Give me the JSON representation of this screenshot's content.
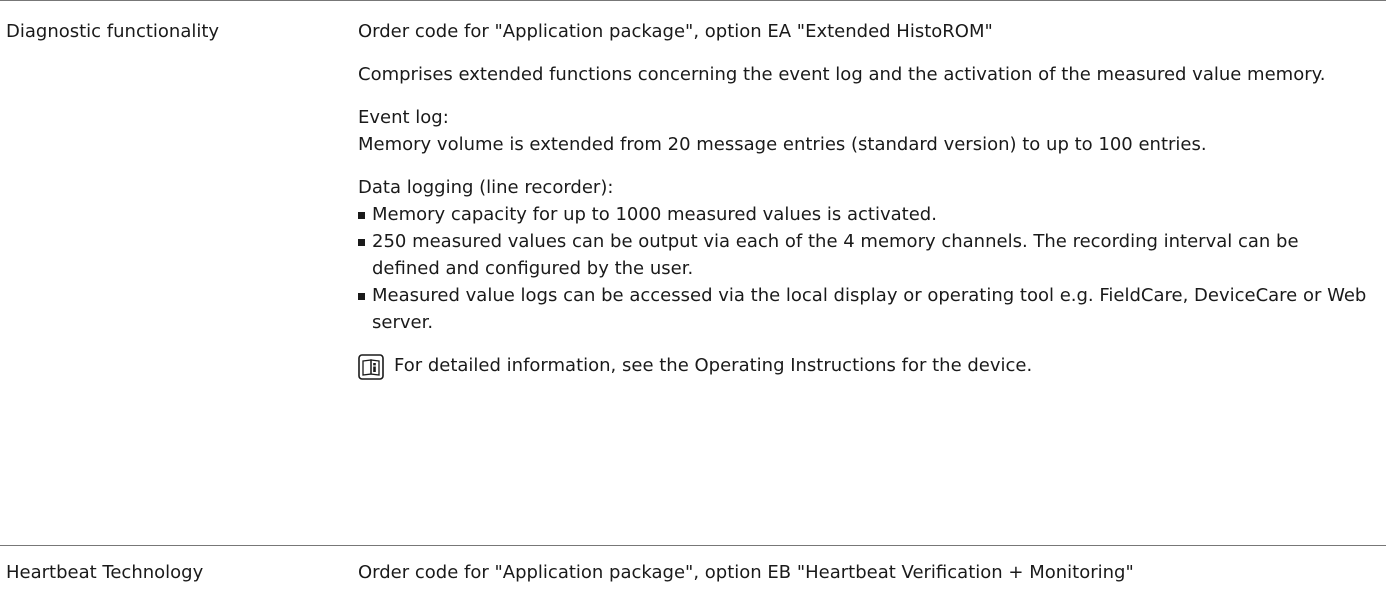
{
  "section1": {
    "label": "Diagnostic functionality",
    "order_code": "Order code for \"Application package\", option EA \"Extended HistoROM\"",
    "intro": "Comprises extended functions concerning the event log and the activation of the measured value memory.",
    "event_log_heading": "Event log:",
    "event_log_text": "Memory volume is extended from 20 message entries (standard version) to up to 100 entries.",
    "data_logging_heading": "Data logging (line recorder):",
    "bullets": [
      "Memory capacity for up to 1000 measured values is activated.",
      "250 measured values can be output via each of the 4 memory channels. The recording interval can be defined and configured by the user.",
      "Measured value logs can be accessed via the local display or operating tool e.g. FieldCare, DeviceCare or Web server."
    ],
    "note_icon": "book-info-icon",
    "note_text": "For detailed information, see the Operating Instructions for the device."
  },
  "section2": {
    "label": "Heartbeat Technology",
    "order_code": "Order code for \"Application package\", option EB \"Heartbeat Verification + Monitoring\""
  }
}
